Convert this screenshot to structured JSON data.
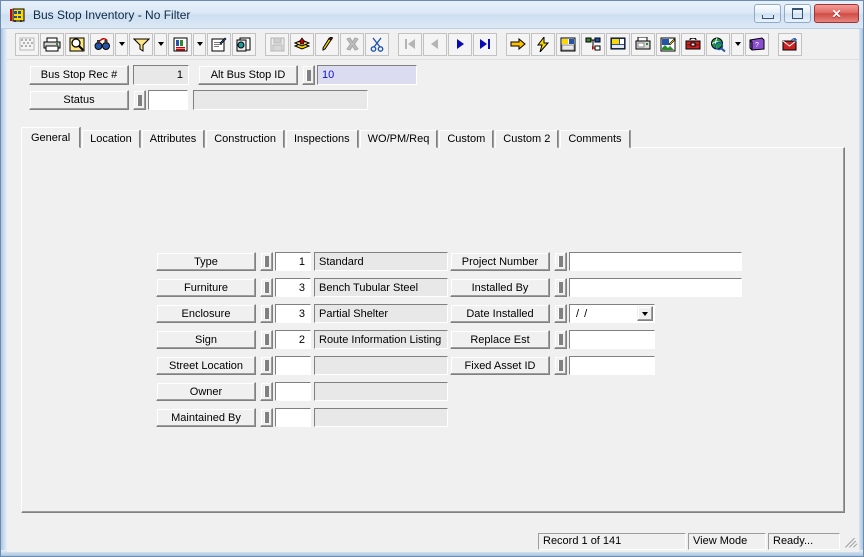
{
  "window": {
    "title": "Bus Stop Inventory - No Filter",
    "icon": "bus-icon",
    "minimize_label": "Minimize",
    "restore_label": "Restore",
    "close_label": "Close"
  },
  "toolbar": {
    "buttons": [
      {
        "name": "grid-view-button",
        "icon": "grid-icon",
        "disabled": true
      },
      {
        "name": "print-button",
        "icon": "printer-icon",
        "disabled": false
      },
      {
        "name": "print-preview-button",
        "icon": "print-preview-icon",
        "disabled": false
      },
      {
        "name": "find-button",
        "icon": "binoculars-icon",
        "disabled": false,
        "dropdown": true
      },
      {
        "name": "filter-button",
        "icon": "funnel-icon",
        "disabled": false,
        "dropdown": true
      },
      {
        "name": "report-button",
        "icon": "report-icon",
        "disabled": false,
        "dropdown": true
      },
      {
        "name": "form-properties-button",
        "icon": "form-pen-icon",
        "disabled": false
      },
      {
        "name": "copy-record-button",
        "icon": "copy-record-icon",
        "disabled": false
      },
      {
        "name": "save-button",
        "icon": "floppy-save-icon",
        "disabled": true
      },
      {
        "name": "add-record-button",
        "icon": "add-layers-icon",
        "disabled": false
      },
      {
        "name": "edit-record-button",
        "icon": "pencil-icon",
        "disabled": false
      },
      {
        "name": "delete-record-button",
        "icon": "delete-x-icon",
        "disabled": true
      },
      {
        "name": "cut-button",
        "icon": "scissors-icon",
        "disabled": false
      },
      {
        "name": "first-record-button",
        "icon": "first-record-icon",
        "disabled": true
      },
      {
        "name": "previous-record-button",
        "icon": "previous-record-icon",
        "disabled": true
      },
      {
        "name": "next-record-button",
        "icon": "next-record-icon",
        "disabled": false
      },
      {
        "name": "last-record-button",
        "icon": "last-record-icon",
        "disabled": false
      },
      {
        "name": "goto-button",
        "icon": "yellow-arrow-icon",
        "disabled": false
      },
      {
        "name": "quick-action-button",
        "icon": "lightning-icon",
        "disabled": false
      },
      {
        "name": "layout-button",
        "icon": "layout-icon",
        "disabled": false
      },
      {
        "name": "hierarchy-button",
        "icon": "hierarchy-icon",
        "disabled": false
      },
      {
        "name": "screen-button",
        "icon": "monitor-icon",
        "disabled": false
      },
      {
        "name": "fax-button",
        "icon": "fax-icon",
        "disabled": false
      },
      {
        "name": "attachment-button",
        "icon": "picture-pen-icon",
        "disabled": false
      },
      {
        "name": "toolbox-button",
        "icon": "toolbox-icon",
        "disabled": false
      },
      {
        "name": "map-button",
        "icon": "globe-search-icon",
        "disabled": false,
        "dropdown": true
      },
      {
        "name": "help-button",
        "icon": "help-book-icon",
        "disabled": false
      },
      {
        "name": "export-button",
        "icon": "export-icon",
        "disabled": false
      }
    ]
  },
  "header": {
    "rec_label": "Bus Stop Rec #",
    "rec_value": "1",
    "alt_id_label": "Alt Bus Stop ID",
    "alt_id_value": "10",
    "status_label": "Status",
    "status_code": "",
    "status_desc": ""
  },
  "tabs": [
    {
      "label": "General",
      "active": true
    },
    {
      "label": "Location",
      "active": false
    },
    {
      "label": "Attributes",
      "active": false
    },
    {
      "label": "Construction",
      "active": false
    },
    {
      "label": "Inspections",
      "active": false
    },
    {
      "label": "WO/PM/Req",
      "active": false
    },
    {
      "label": "Custom",
      "active": false
    },
    {
      "label": "Custom 2",
      "active": false
    },
    {
      "label": "Comments",
      "active": false
    }
  ],
  "general": {
    "left_fields": [
      {
        "label": "Type",
        "code": "1",
        "desc": "Standard"
      },
      {
        "label": "Furniture",
        "code": "3",
        "desc": "Bench Tubular Steel"
      },
      {
        "label": "Enclosure",
        "code": "3",
        "desc": "Partial Shelter"
      },
      {
        "label": "Sign",
        "code": "2",
        "desc": "Route Information Listing"
      },
      {
        "label": "Street Location",
        "code": "",
        "desc": ""
      },
      {
        "label": "Owner",
        "code": "",
        "desc": ""
      },
      {
        "label": "Maintained By",
        "code": "",
        "desc": ""
      }
    ],
    "right_fields": [
      {
        "label": "Project Number",
        "value": "",
        "kind": "wide"
      },
      {
        "label": "Installed By",
        "value": "",
        "kind": "wide"
      },
      {
        "label": "Date Installed",
        "value": "/  /",
        "kind": "date"
      },
      {
        "label": "Replace Est",
        "value": "",
        "kind": "medium"
      },
      {
        "label": "Fixed Asset ID",
        "value": "",
        "kind": "medium"
      }
    ]
  },
  "statusbar": {
    "record": "Record 1 of 141",
    "mode": "View Mode",
    "state": "Ready..."
  },
  "colors": {
    "accent": "#1111cc",
    "highlight_field": "#dcdcf0",
    "face": "#f0f0f0",
    "close_button": "#cf4b44"
  }
}
